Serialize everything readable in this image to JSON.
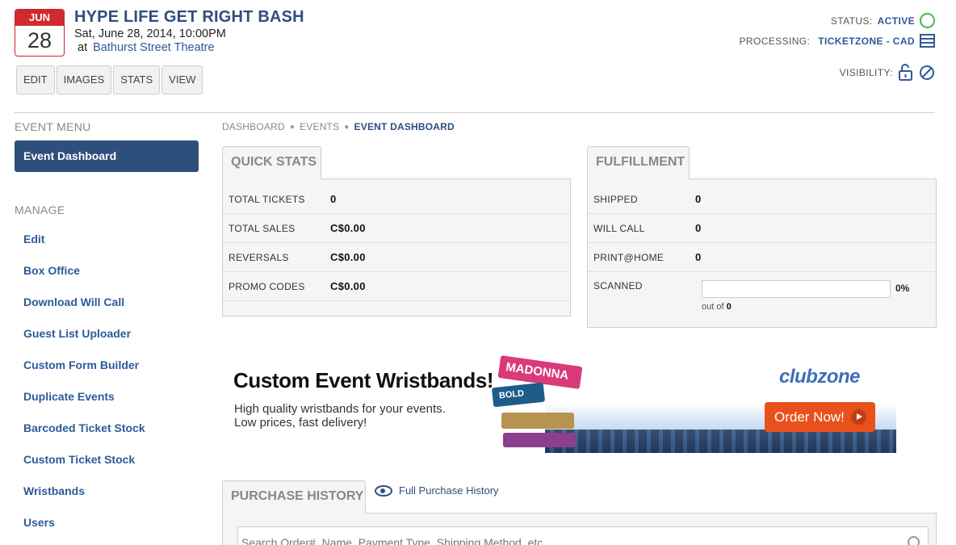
{
  "event": {
    "month": "JUN",
    "day": "28",
    "title": "HYPE LIFE GET RIGHT BASH",
    "date": "Sat, June 28, 2014, 10:00PM",
    "at": "at",
    "venue": "Bathurst Street Theatre"
  },
  "tabs": [
    "EDIT",
    "IMAGES",
    "STATS",
    "VIEW"
  ],
  "status": {
    "status_label": "STATUS:",
    "status_value": "ACTIVE",
    "processing_label": "PROCESSING:",
    "processing_value": "TICKETZONE - CAD",
    "visibility_label": "VISIBILITY:"
  },
  "sidebar": {
    "event_menu_heading": "EVENT MENU",
    "active_item": "Event Dashboard",
    "manage_heading": "MANAGE",
    "items": [
      "Edit",
      "Box Office",
      "Download Will Call",
      "Guest List Uploader",
      "Custom Form Builder",
      "Duplicate Events",
      "Barcoded Ticket Stock",
      "Custom Ticket Stock",
      "Wristbands",
      "Users"
    ]
  },
  "breadcrumb": [
    "DASHBOARD",
    "EVENTS",
    "EVENT DASHBOARD"
  ],
  "quick_stats": {
    "title": "QUICK STATS",
    "rows": [
      {
        "label": "TOTAL TICKETS",
        "value": "0"
      },
      {
        "label": "TOTAL SALES",
        "value": "C$0.00"
      },
      {
        "label": "REVERSALS",
        "value": "C$0.00"
      },
      {
        "label": "PROMO CODES",
        "value": "C$0.00"
      }
    ]
  },
  "fulfillment": {
    "title": "FULFILLMENT",
    "rows": [
      {
        "label": "SHIPPED",
        "value": "0"
      },
      {
        "label": "WILL CALL",
        "value": "0"
      },
      {
        "label": "PRINT@HOME",
        "value": "0"
      }
    ],
    "scanned_label": "SCANNED",
    "scanned_pct": "0%",
    "scanned_fraction": 0,
    "out_of_text": "out of",
    "out_of_value": "0"
  },
  "banner": {
    "title": "Custom Event Wristbands!",
    "line1": "High quality wristbands for your events.",
    "line2": "Low prices, fast delivery!",
    "brand": "clubzone",
    "cta": "Order Now!",
    "band1": "MADONNA",
    "band2": "BOLD"
  },
  "purchase_history": {
    "title": "PURCHASE HISTORY",
    "full_link": "Full Purchase History",
    "search_placeholder": "Search Order#, Name, Payment Type, Shipping Method, etc..."
  }
}
